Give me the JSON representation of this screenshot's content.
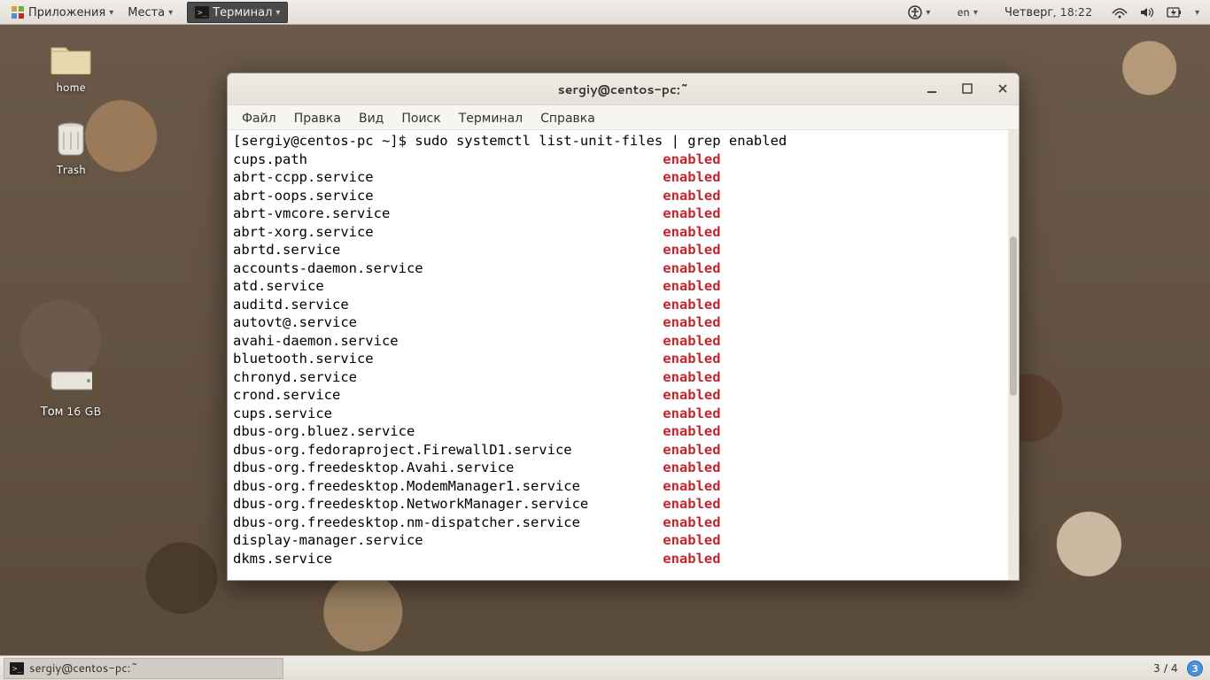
{
  "top_panel": {
    "applications": "Приложения",
    "places": "Места",
    "terminal_task": "Терминал",
    "lang": "en",
    "clock": "Четверг, 18:22"
  },
  "desktop": {
    "home": "home",
    "trash": "Trash",
    "volume": "Том 16 GB"
  },
  "window": {
    "title": "sergiy@centos-pc:~",
    "menu": {
      "file": "Файл",
      "edit": "Правка",
      "view": "Вид",
      "search": "Поиск",
      "terminal": "Терминал",
      "help": "Справка"
    }
  },
  "terminal": {
    "prompt": "[sergiy@centos-pc ~]$ ",
    "command": "sudo systemctl list-unit-files | grep enabled",
    "status": "enabled",
    "units": [
      "cups.path",
      "abrt-ccpp.service",
      "abrt-oops.service",
      "abrt-vmcore.service",
      "abrt-xorg.service",
      "abrtd.service",
      "accounts-daemon.service",
      "atd.service",
      "auditd.service",
      "autovt@.service",
      "avahi-daemon.service",
      "bluetooth.service",
      "chronyd.service",
      "crond.service",
      "cups.service",
      "dbus-org.bluez.service",
      "dbus-org.fedoraproject.FirewallD1.service",
      "dbus-org.freedesktop.Avahi.service",
      "dbus-org.freedesktop.ModemManager1.service",
      "dbus-org.freedesktop.NetworkManager.service",
      "dbus-org.freedesktop.nm-dispatcher.service",
      "display-manager.service",
      "dkms.service"
    ]
  },
  "bottom_panel": {
    "task": "sergiy@centos-pc:~",
    "workspace": "3 / 4",
    "badge": "3"
  }
}
